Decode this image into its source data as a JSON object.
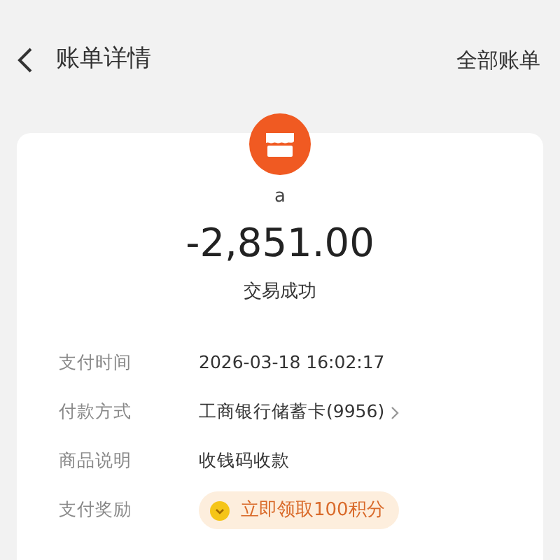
{
  "header": {
    "title": "账单详情",
    "action": "全部账单"
  },
  "summary": {
    "merchant": "a",
    "amount": "-2,851.00",
    "status": "交易成功"
  },
  "details": [
    {
      "kind": "text",
      "label": "支付时间",
      "value": "2026-03-18 16:02:17"
    },
    {
      "kind": "link",
      "label": "付款方式",
      "value": "工商银行储蓄卡(9956)"
    },
    {
      "kind": "text",
      "label": "商品说明",
      "value": "收钱码收款"
    },
    {
      "kind": "reward",
      "label": "支付奖励",
      "value": "立即领取100积分"
    }
  ]
}
